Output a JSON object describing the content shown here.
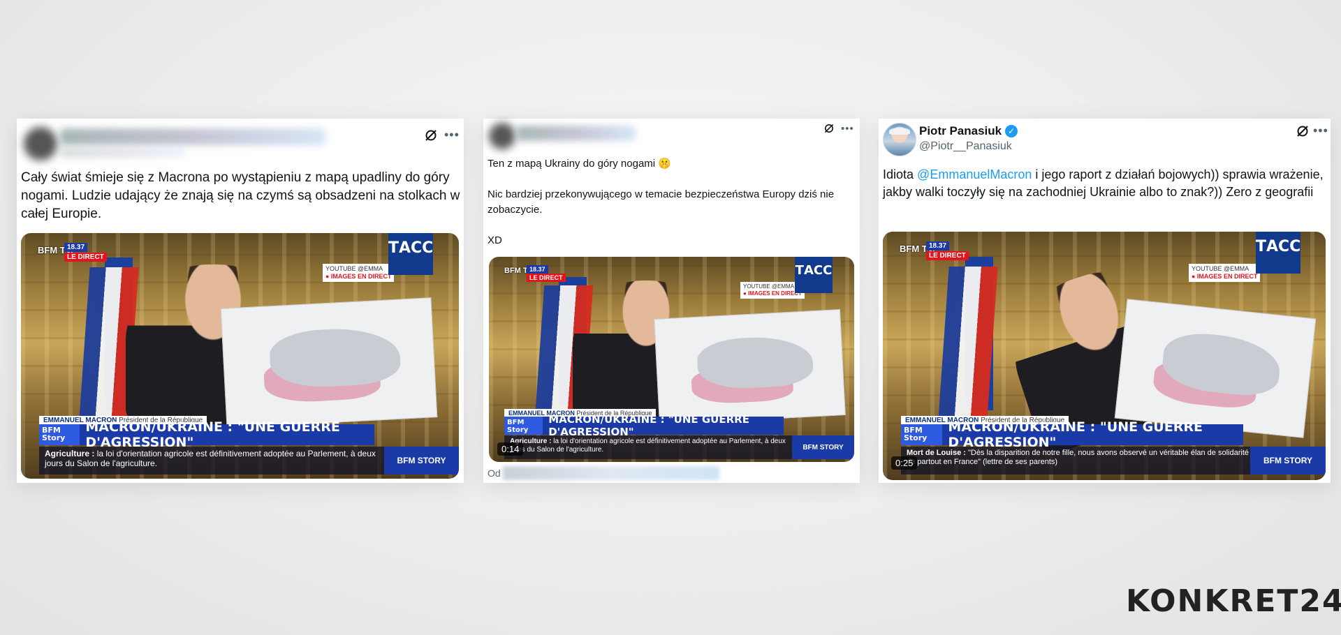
{
  "tweets": [
    {
      "author_name": "",
      "handle": "",
      "text": "Cały świat śmieje się z Macrona po wystąpieniu z mapą upadliny do góry nogami. Ludzie udający że znają się na czymś są obsadzeni na stolkach w całej Europie.",
      "video": {
        "channel": "BFM TV.",
        "clock": "18.37",
        "live_badge": "LE DIRECT",
        "youtube_label": "YOUTUBE @EMMA",
        "images_label": "● IMAGES EN DIRECT",
        "agency": "ТАСС",
        "speaker_name": "EMMANUEL MACRON",
        "speaker_role": "Président de la République",
        "show_tag": "BFM Story",
        "headline": "MACRON/UKRAINE : \"UNE GUERRE D'AGRESSION\"",
        "ticker_label": "Agriculture :",
        "ticker_text": "la loi d'orientation agricole est définitivement adoptée au Parlement, à deux jours du Salon de l'agriculture.",
        "story_label": "BFM STORY",
        "duration": ""
      }
    },
    {
      "author_name": "",
      "handle": "",
      "text_lines": [
        "Ten z mapą Ukrainy do góry nogami 🤫",
        "Nic bardziej przekonywującego w temacie bezpieczeństwa Europy dziś nie zobaczycie.",
        "XD"
      ],
      "video": {
        "channel": "BFM TV.",
        "clock": "18.37",
        "live_badge": "LE DIRECT",
        "youtube_label": "YOUTUBE @EMMA",
        "images_label": "● IMAGES EN DIRECT",
        "agency": "ТАСС",
        "speaker_name": "EMMANUEL MACRON",
        "speaker_role": "Président de la République",
        "show_tag": "BFM Story",
        "headline": "MACRON/UKRAINE : \"UNE GUERRE D'AGRESSION\"",
        "ticker_label": "Agriculture :",
        "ticker_text": "la loi d'orientation agricole est définitivement adoptée au Parlement, à deux jours du Salon de l'agriculture.",
        "story_label": "BFM STORY",
        "duration": "0:14"
      },
      "source_prefix": "Od"
    },
    {
      "author_name": "Piotr Panasiuk",
      "handle": "@Piotr__Panasiuk",
      "text_pre": "Idiota ",
      "mention": "@EmmanuelMacron",
      "text_post": " i jego raport z działań bojowych)) sprawia wrażenie, jakby walki toczyły się na zachodniej Ukrainie albo to znak?)) Zero z geografii",
      "video": {
        "channel": "BFM TV.",
        "clock": "18.37",
        "live_badge": "LE DIRECT",
        "youtube_label": "YOUTUBE @EMMA",
        "images_label": "● IMAGES EN DIRECT",
        "agency": "ТАСС",
        "speaker_name": "EMMANUEL MACRON",
        "speaker_role": "Président de la République",
        "show_tag": "BFM Story",
        "headline": "MACRON/UKRAINE : \"UNE GUERRE D'AGRESSION\"",
        "ticker_label": "Mort de Louise :",
        "ticker_text": "\"Dès la disparition de notre fille, nous avons observé un véritable élan de solidarité de partout en France\" (lettre de ses parents)",
        "story_label": "BFM STORY",
        "duration": "0:25"
      }
    }
  ],
  "watermark": "KONKRET24",
  "colors": {
    "link": "#1d9bf0",
    "verified": "#1d9bf0",
    "bfm_blue": "#1a3aa8",
    "live_red": "#e3141b"
  }
}
